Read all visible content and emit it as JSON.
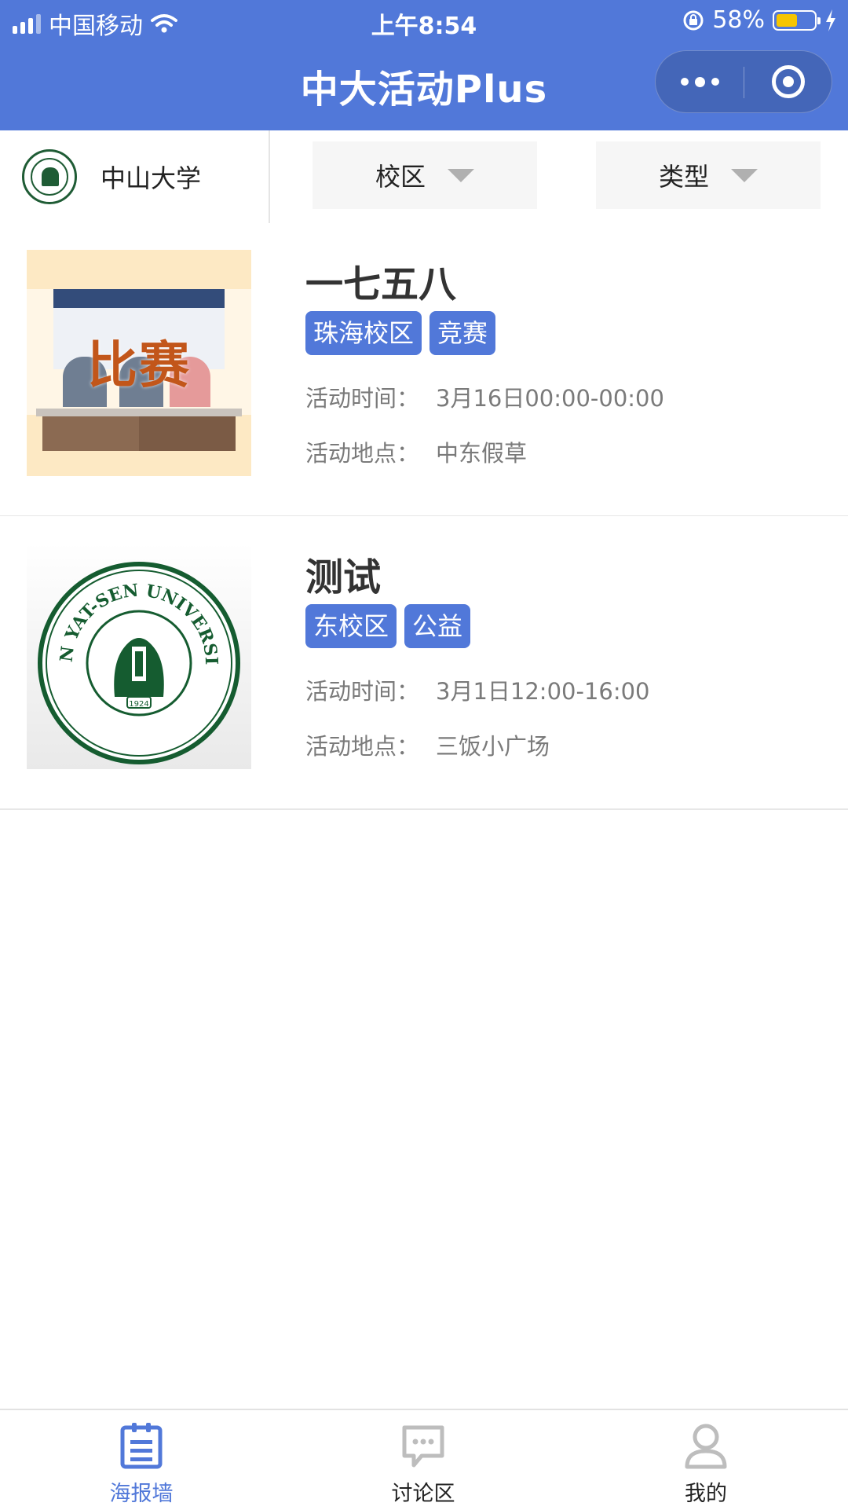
{
  "status_bar": {
    "carrier": "中国移动",
    "time": "上午8:54",
    "battery_percent": "58%",
    "battery_level": 0.58
  },
  "nav": {
    "title": "中大活动Plus",
    "more_icon": "more-dots-icon",
    "close_icon": "target-circle-icon"
  },
  "filter": {
    "school_name": "中山大学",
    "campus_label": "校区",
    "type_label": "类型"
  },
  "events": [
    {
      "title": "一七五八",
      "tags": [
        "珠海校区",
        "竞赛"
      ],
      "time_label": "活动时间：",
      "time": "3月16日00:00-00:00",
      "place_label": "活动地点：",
      "place": "中东假草",
      "thumb_text": "比赛"
    },
    {
      "title": "测试",
      "tags": [
        "东校区",
        "公益"
      ],
      "time_label": "活动时间：",
      "time": "3月1日12:00-16:00",
      "place_label": "活动地点：",
      "place": "三饭小广场",
      "seal_text": "SUN YAT-SEN UNIVERSITY",
      "seal_year": "1924"
    }
  ],
  "tabbar": {
    "items": [
      {
        "label": "海报墙",
        "icon": "clipboard-icon",
        "active": true
      },
      {
        "label": "讨论区",
        "icon": "chat-bubble-icon",
        "active": false
      },
      {
        "label": "我的",
        "icon": "person-icon",
        "active": false
      }
    ]
  },
  "colors": {
    "accent": "#5178d9",
    "tab_active": "#5178d9",
    "tab_inactive": "#bdbdbd"
  }
}
